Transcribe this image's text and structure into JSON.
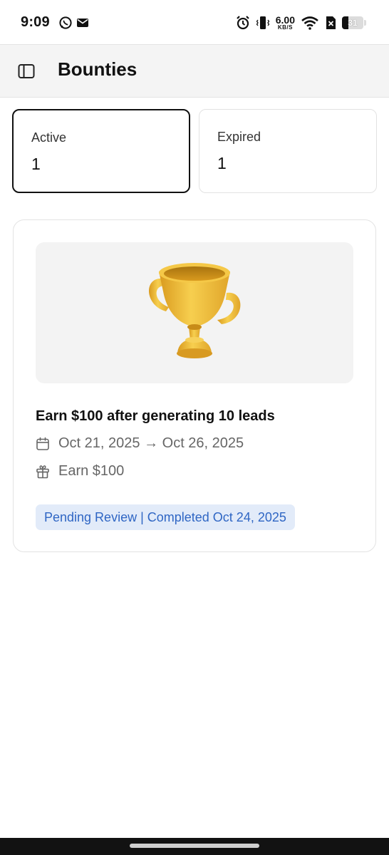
{
  "status_bar": {
    "time": "9:09",
    "net_speed_value": "6.00",
    "net_speed_unit": "KB/S",
    "battery_level": "31",
    "icons": [
      "whatsapp-icon",
      "mail-icon",
      "alarm-icon",
      "vibrate-icon",
      "wifi-icon",
      "no-sim-icon",
      "battery-icon"
    ]
  },
  "header": {
    "title": "Bounties",
    "menu_icon": "sidebar-toggle-icon"
  },
  "stats": [
    {
      "label": "Active",
      "value": "1",
      "selected": true
    },
    {
      "label": "Expired",
      "value": "1",
      "selected": false
    }
  ],
  "bounty": {
    "image": "trophy",
    "title": "Earn $100 after generating 10 leads",
    "date_range": "Oct 21, 2025 → Oct 26, 2025",
    "reward": "Earn $100",
    "status": "Pending Review | Completed Oct 24, 2025",
    "status_color": "#2f66c4",
    "status_bg": "#e2ebf9"
  },
  "colors": {
    "header_bg": "#f4f4f4",
    "selected_border": "#111111",
    "trophy_gold": "#f2bd3a"
  }
}
